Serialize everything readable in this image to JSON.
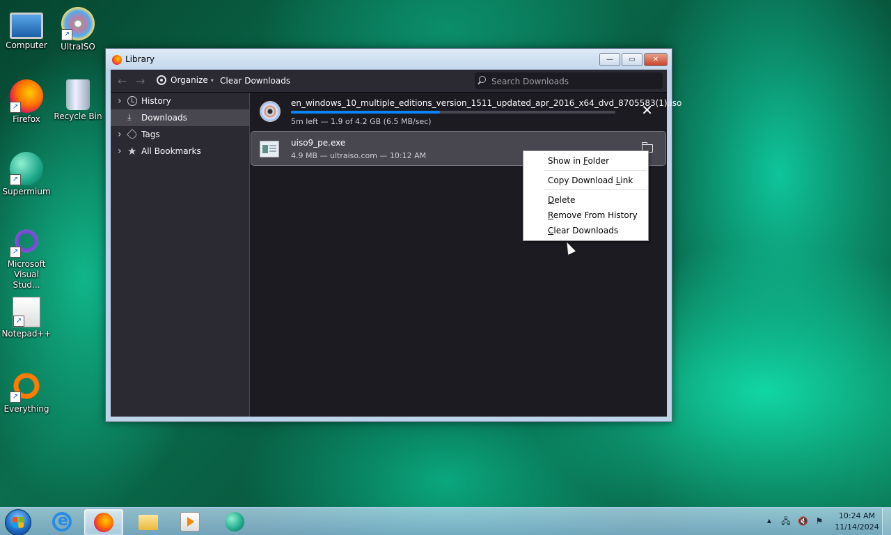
{
  "desktop": {
    "icons": [
      {
        "label": "Computer"
      },
      {
        "label": "UltraISO"
      },
      {
        "label": "Firefox"
      },
      {
        "label": "Recycle Bin"
      },
      {
        "label": "Supermium"
      },
      {
        "label": "Microsoft Visual Stud..."
      },
      {
        "label": "Notepad++"
      },
      {
        "label": "Everything"
      }
    ]
  },
  "window": {
    "title": "Library",
    "minimize": "—",
    "maximize": "▭",
    "close": "✕"
  },
  "toolbar": {
    "back": "←",
    "forward": "→",
    "organize_label": "Organize",
    "organize_caret": "▾",
    "clear_downloads": "Clear Downloads",
    "search_placeholder": "Search Downloads"
  },
  "sidebar": {
    "items": [
      {
        "label": "History",
        "icon": "clock-icon",
        "twisty": "›"
      },
      {
        "label": "Downloads",
        "icon": "download-icon",
        "glyph": "⤓"
      },
      {
        "label": "Tags",
        "icon": "tag-icon",
        "twisty": "›"
      },
      {
        "label": "All Bookmarks",
        "icon": "star-icon",
        "glyph": "★",
        "twisty": "›"
      }
    ]
  },
  "downloads": [
    {
      "filename": "en_windows_10_multiple_editions_version_1511_updated_apr_2016_x64_dvd_8705583(1).iso",
      "status": "5m left — 1.9 of 4.2 GB (6.5 MB/sec)",
      "progress": 0.46,
      "action": "✕"
    },
    {
      "filename": "uiso9_pe.exe",
      "status": "4.9 MB — ultraiso.com — 10:12 AM"
    }
  ],
  "context_menu": {
    "items": [
      {
        "pre": "Show in ",
        "acc": "F",
        "post": "older"
      },
      {
        "pre": "Copy Download ",
        "acc": "L",
        "post": "ink"
      },
      {
        "pre": "",
        "acc": "D",
        "post": "elete"
      },
      {
        "pre": "",
        "acc": "R",
        "post": "emove From History"
      },
      {
        "pre": "",
        "acc": "C",
        "post": "lear Downloads"
      }
    ]
  },
  "taskbar": {
    "clock_time": "10:24 AM",
    "clock_date": "11/14/2024",
    "tray_expand": "▲",
    "tray_network": "🖧",
    "tray_volume": "🔇",
    "tray_flag": "⚑"
  }
}
